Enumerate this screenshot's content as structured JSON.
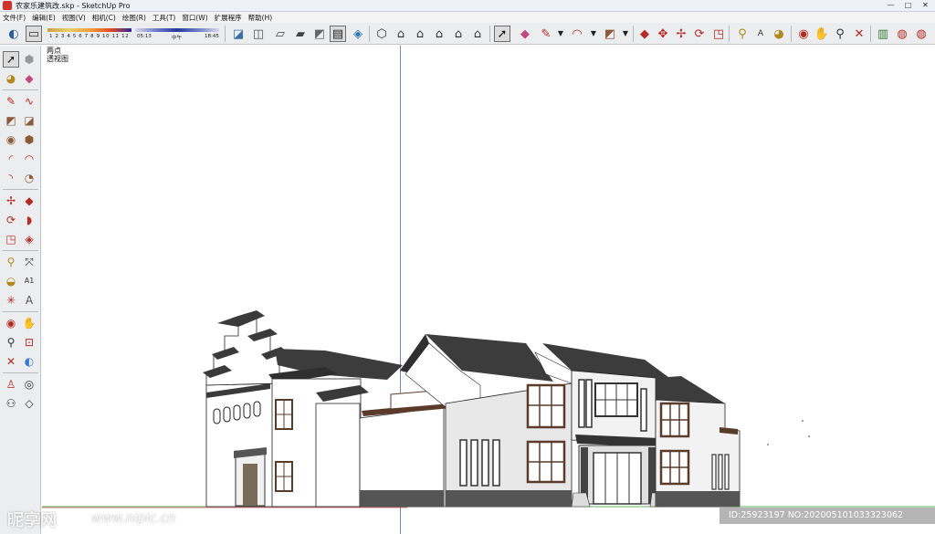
{
  "window": {
    "title": "农家乐建筑改.skp - SketchUp Pro",
    "controls": [
      "—",
      "□",
      "✕"
    ]
  },
  "menu": [
    "文件(F)",
    "编辑(E)",
    "视图(V)",
    "相机(C)",
    "绘图(R)",
    "工具(T)",
    "窗口(W)",
    "扩展程序",
    "帮助(H)"
  ],
  "shadow_settings": {
    "month_ticks": "1 2 3 4 5 6 7 8 9 10 11 12",
    "time_start": "05:13",
    "time_mid": "中午",
    "time_end": "18:45"
  },
  "viewport": {
    "camera_mode": "两点",
    "view_name": "透视图"
  },
  "watermark": {
    "logo": "昵享网",
    "site": "www.nipic.cn",
    "id_text": "ID:25923197 NO:20200510103332306​2"
  },
  "colors": {
    "axis_blue": "#7b84c9",
    "axis_green": "#5fb35f",
    "axis_red": "#d05050",
    "roof": "#3c3c3c",
    "wall": "#ffffff",
    "wall_shade": "#e4e4e4",
    "frame": "#5a3b2a"
  }
}
